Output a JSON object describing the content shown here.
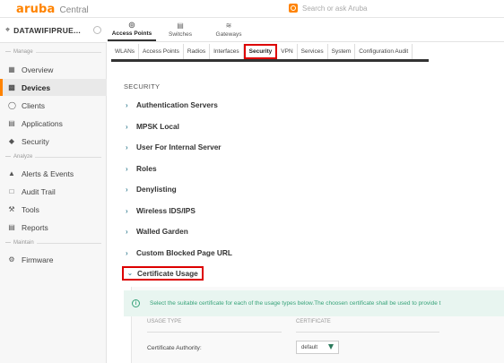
{
  "header": {
    "brand": "aruba",
    "app_name": "Central",
    "search_placeholder": "Search or ask Aruba"
  },
  "sidebar": {
    "context_name": "DATAWIFIPRUE...",
    "sections": {
      "manage": "Manage",
      "analyze": "Analyze",
      "maintain": "Maintain"
    },
    "items": [
      {
        "label": "Overview",
        "icon": "grid-icon"
      },
      {
        "label": "Devices",
        "icon": "devices-icon"
      },
      {
        "label": "Clients",
        "icon": "user-icon"
      },
      {
        "label": "Applications",
        "icon": "applications-icon"
      },
      {
        "label": "Security",
        "icon": "shield-icon"
      },
      {
        "label": "Alerts & Events",
        "icon": "bell-icon"
      },
      {
        "label": "Audit Trail",
        "icon": "audit-icon"
      },
      {
        "label": "Tools",
        "icon": "wrench-icon"
      },
      {
        "label": "Reports",
        "icon": "reports-icon"
      },
      {
        "label": "Firmware",
        "icon": "gear-icon"
      }
    ],
    "active_item": "Devices"
  },
  "device_tabs": [
    {
      "label": "Access Points",
      "icon": "access-point-icon"
    },
    {
      "label": "Switches",
      "icon": "switch-icon"
    },
    {
      "label": "Gateways",
      "icon": "gateway-icon"
    }
  ],
  "subtabs": [
    "WLANs",
    "Access Points",
    "Radios",
    "Interfaces",
    "Security",
    "VPN",
    "Services",
    "System",
    "Configuration Audit"
  ],
  "active_subtab": "Security",
  "content": {
    "section_title": "SECURITY",
    "accordion": [
      "Authentication Servers",
      "MPSK Local",
      "User For Internal Server",
      "Roles",
      "Denylisting",
      "Wireless IDS/IPS",
      "Walled Garden",
      "Custom Blocked Page URL",
      "Certificate Usage"
    ],
    "expanded": "Certificate Usage",
    "info_text": "Select the suitable certificate for each of the usage types below.The choosen certificate shall be used to provide t",
    "columns": [
      "USAGE TYPE",
      "CERTIFICATE"
    ],
    "row": {
      "label": "Certificate Authority:",
      "value": "default"
    }
  },
  "colors": {
    "brand_orange": "#ff8300",
    "highlight_red": "#dd0000",
    "info_green": "#38a37a",
    "chevron_teal": "#4a8a9c"
  }
}
